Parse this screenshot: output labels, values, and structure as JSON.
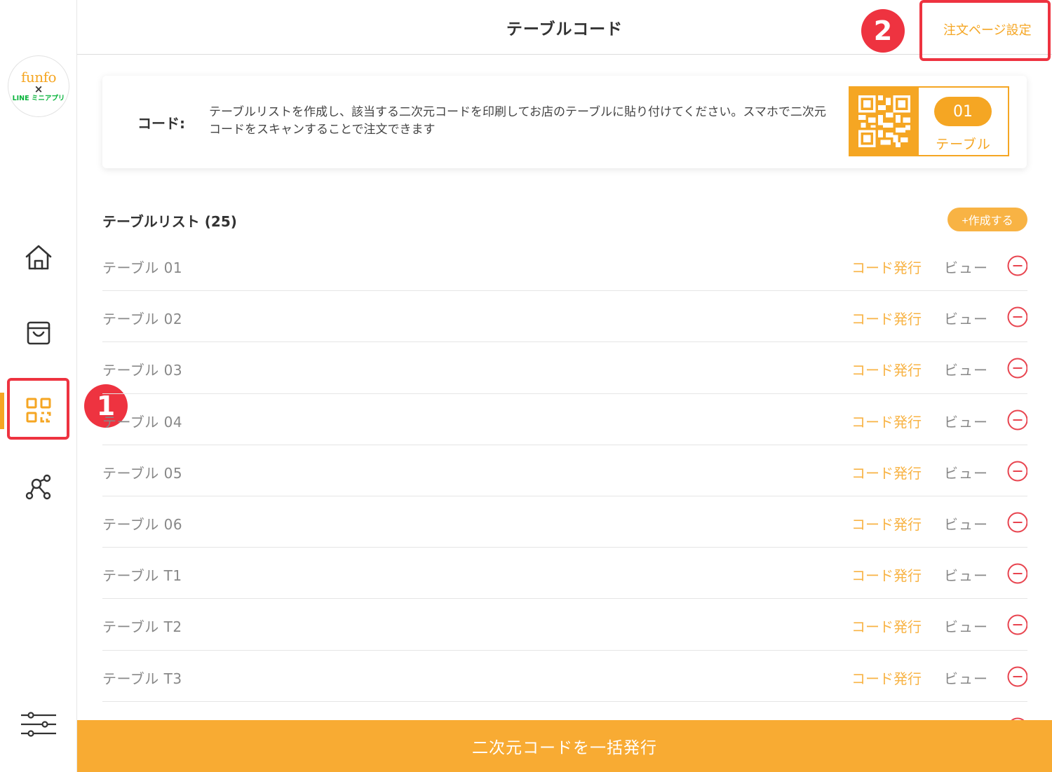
{
  "logo": {
    "brand": "funfo",
    "times": "×",
    "partner": "LINE ミニアプリ"
  },
  "header": {
    "title": "テーブルコード",
    "settings_link": "注文ページ設定"
  },
  "annotations": {
    "badge1": "1",
    "badge2": "2"
  },
  "nav": {
    "items": [
      {
        "icon": "home-icon",
        "active": false
      },
      {
        "icon": "shopping-bag-icon",
        "active": false
      },
      {
        "icon": "qr-code-icon",
        "active": true
      },
      {
        "icon": "network-icon",
        "active": false
      },
      {
        "icon": "sliders-icon",
        "active": false
      }
    ]
  },
  "info": {
    "label": "コード:",
    "description": "テーブルリストを作成し、該当する二次元コードを印刷してお店のテーブルに貼り付けてください。スマホで二次元コードをスキャンすることで注文できます",
    "sample_number": "01",
    "sample_label": "テーブル"
  },
  "list": {
    "title": "テーブルリスト (25)",
    "create_label": "+作成する",
    "issue_label": "コード発行",
    "view_label": "ビュー",
    "rows": [
      {
        "name": "テーブル 01"
      },
      {
        "name": "テーブル 02"
      },
      {
        "name": "テーブル 03"
      },
      {
        "name": "テーブル 04"
      },
      {
        "name": "テーブル 05"
      },
      {
        "name": "テーブル 06"
      },
      {
        "name": "テーブル T1"
      },
      {
        "name": "テーブル T2"
      },
      {
        "name": "テーブル T3"
      },
      {
        "name": ""
      }
    ]
  },
  "footer": {
    "bulk_issue_label": "二次元コードを一括発行"
  },
  "colors": {
    "accent": "#f5a623",
    "highlight": "#ee3340",
    "delete": "#e8444f"
  }
}
